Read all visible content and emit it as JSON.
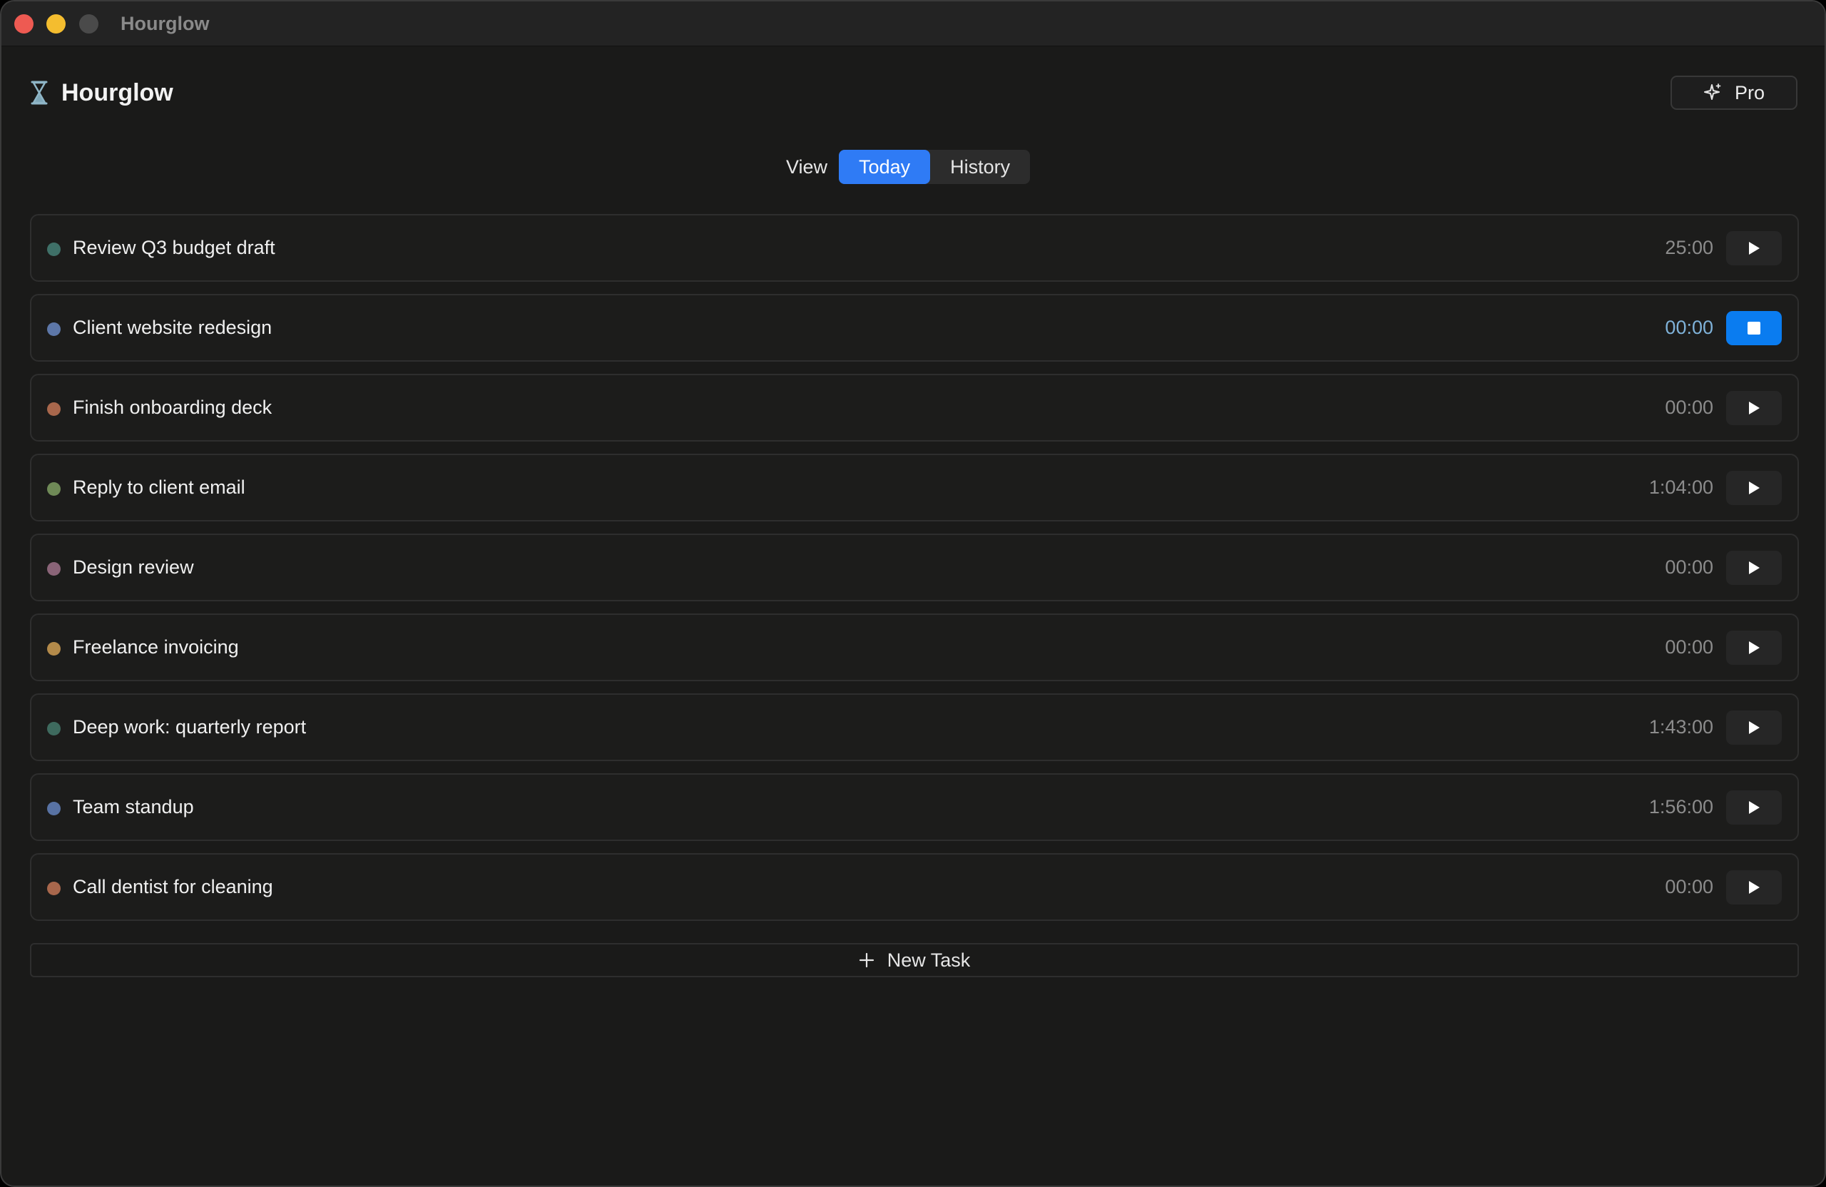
{
  "window": {
    "title": "Hourglow"
  },
  "header": {
    "app_name": "Hourglow",
    "logo_icon": "hourglass-icon",
    "pro_label": "Pro",
    "pro_icon": "sparkle-icon"
  },
  "view_switcher": {
    "label": "View",
    "options": [
      "Today",
      "History"
    ],
    "selected": "Today"
  },
  "tasks": [
    {
      "name": "Review Q3 budget draft",
      "time": "25:00",
      "color": "#3f7068",
      "running": false
    },
    {
      "name": "Client website redesign",
      "time": "00:00",
      "color": "#5d77a8",
      "running": true
    },
    {
      "name": "Finish onboarding deck",
      "time": "00:00",
      "color": "#a8674c",
      "running": false
    },
    {
      "name": "Reply to client email",
      "time": "1:04:00",
      "color": "#6f8a57",
      "running": false
    },
    {
      "name": "Design review",
      "time": "00:00",
      "color": "#8a6478",
      "running": false
    },
    {
      "name": "Freelance invoicing",
      "time": "00:00",
      "color": "#b38a4a",
      "running": false
    },
    {
      "name": "Deep work: quarterly report",
      "time": "1:43:00",
      "color": "#3e6a5e",
      "running": false
    },
    {
      "name": "Team standup",
      "time": "1:56:00",
      "color": "#5872a3",
      "running": false
    },
    {
      "name": "Call dentist for cleaning",
      "time": "00:00",
      "color": "#a8674c",
      "running": false
    }
  ],
  "new_task": {
    "label": "New Task",
    "icon": "plus-icon"
  },
  "colors": {
    "accent": "#2f7bf5",
    "running_button": "#0a7cf0",
    "background": "#1a1a19"
  }
}
